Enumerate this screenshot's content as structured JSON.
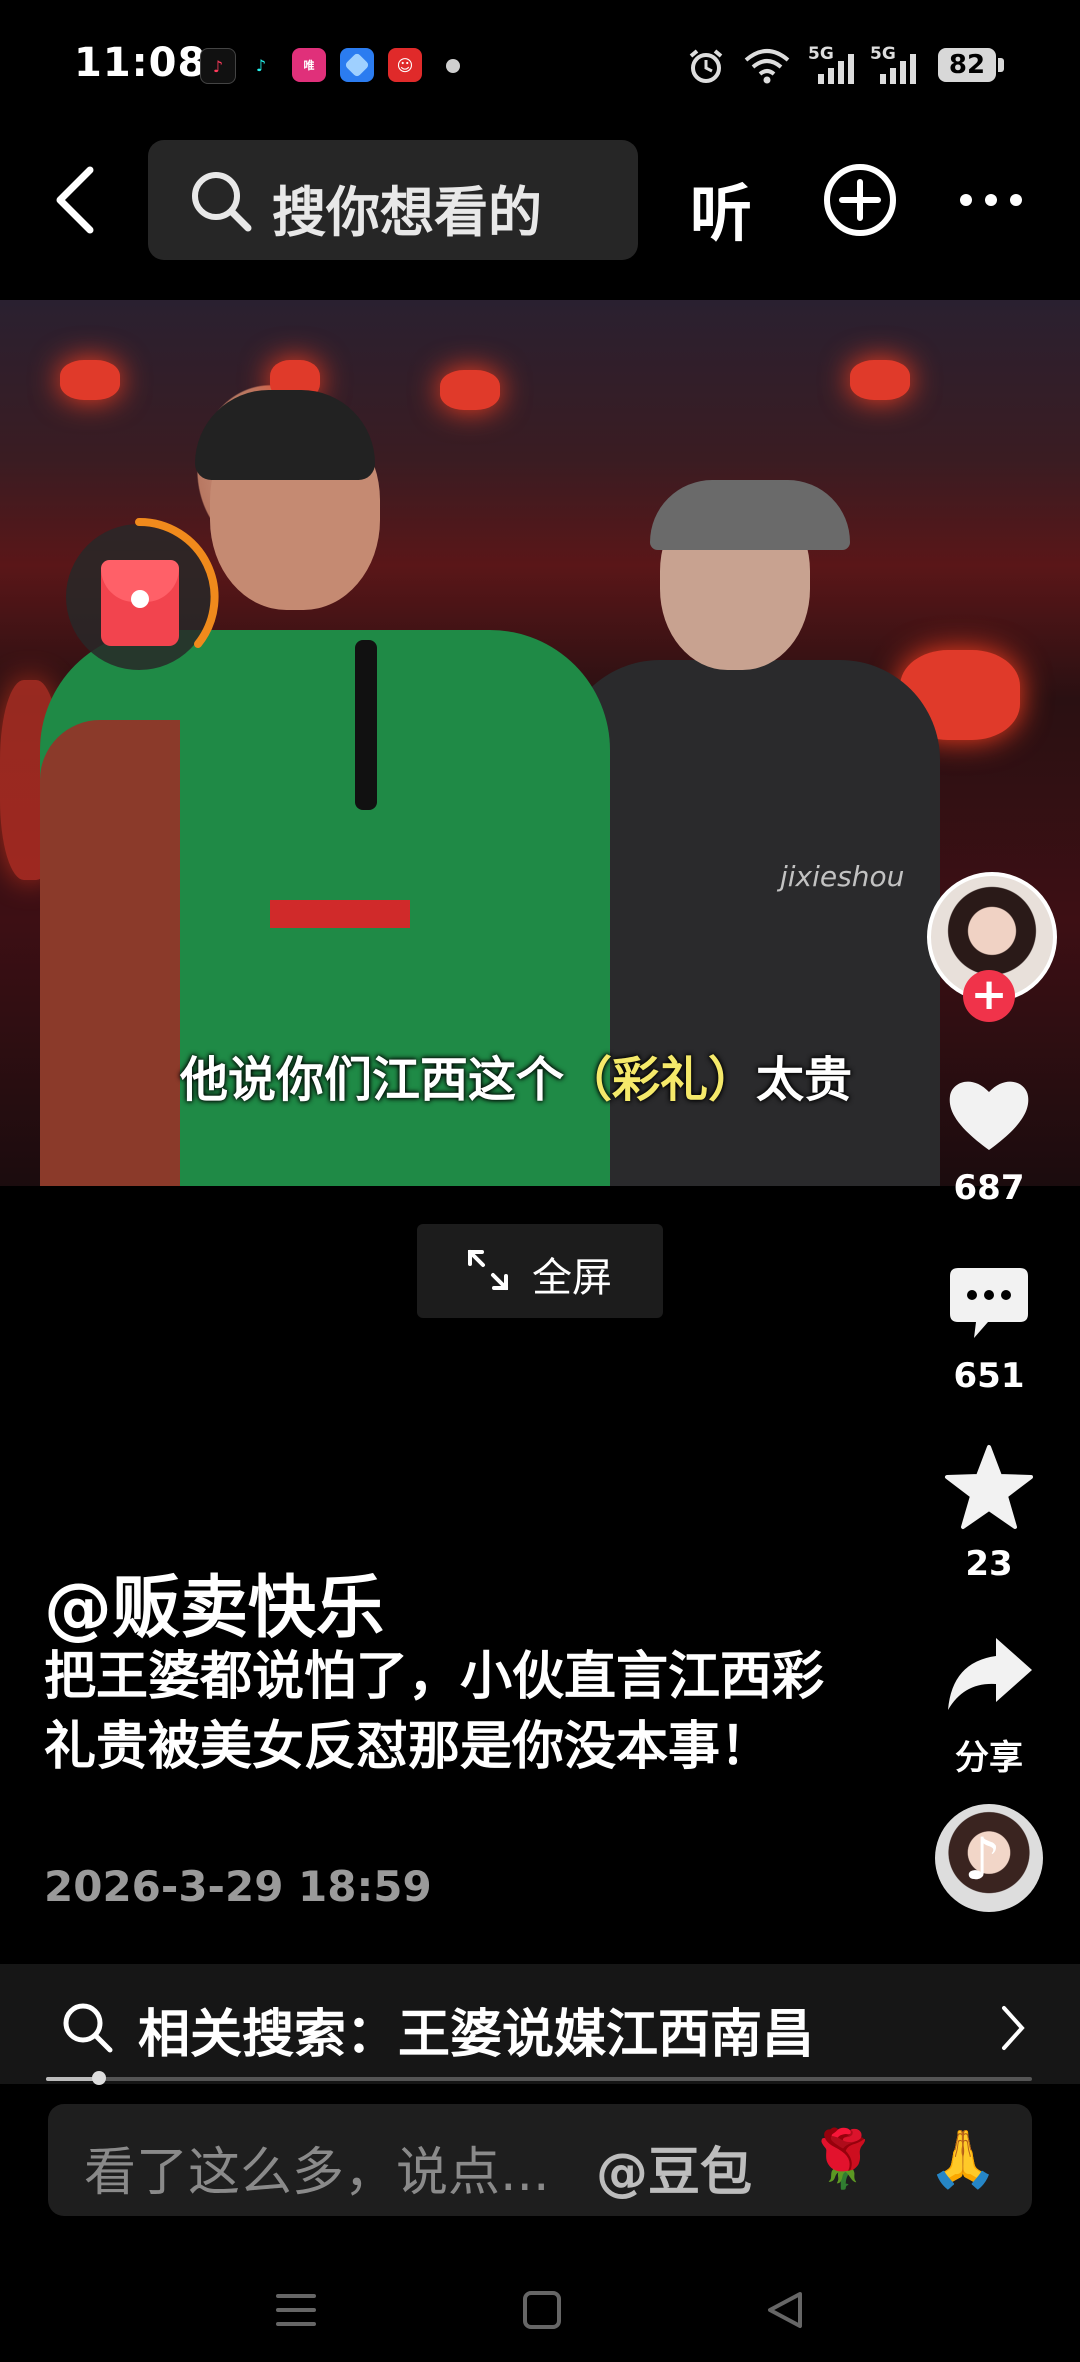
{
  "status_bar": {
    "time": "11:08",
    "apps": [
      "douyin-lite-icon",
      "tiktok-icon",
      "vipshop-icon",
      "browser-icon",
      "game-icon"
    ],
    "network_1": "5G",
    "network_2": "5G",
    "battery": "82"
  },
  "top_nav": {
    "search_placeholder": "搜你想看的",
    "listen_label": "听"
  },
  "video": {
    "subtitle_pre": "他说你们江西这个",
    "subtitle_highlight": "（彩礼）",
    "subtitle_post": "太贵",
    "watermark": "jixieshou",
    "fullscreen_label": "全屏"
  },
  "actions": {
    "like_count": "687",
    "comment_count": "651",
    "favorite_count": "23",
    "share_label": "分享"
  },
  "post": {
    "author": "@贩卖快乐",
    "caption": "把王婆都说怕了，小伙直言江西彩礼贵被美女反怼那是你没本事！",
    "time": "2026-3-29 18:59"
  },
  "related_search": {
    "label": "相关搜索：王婆说媒江西南昌"
  },
  "comment_input": {
    "placeholder": "看了这么多，说点...",
    "mention": "@豆包",
    "emoji_1": "🌹",
    "emoji_2": "🙏"
  },
  "colors": {
    "accent_red": "#f0334a",
    "subtitle_highlight": "#f5e96a",
    "redpacket_ring": "#f08a1c"
  }
}
